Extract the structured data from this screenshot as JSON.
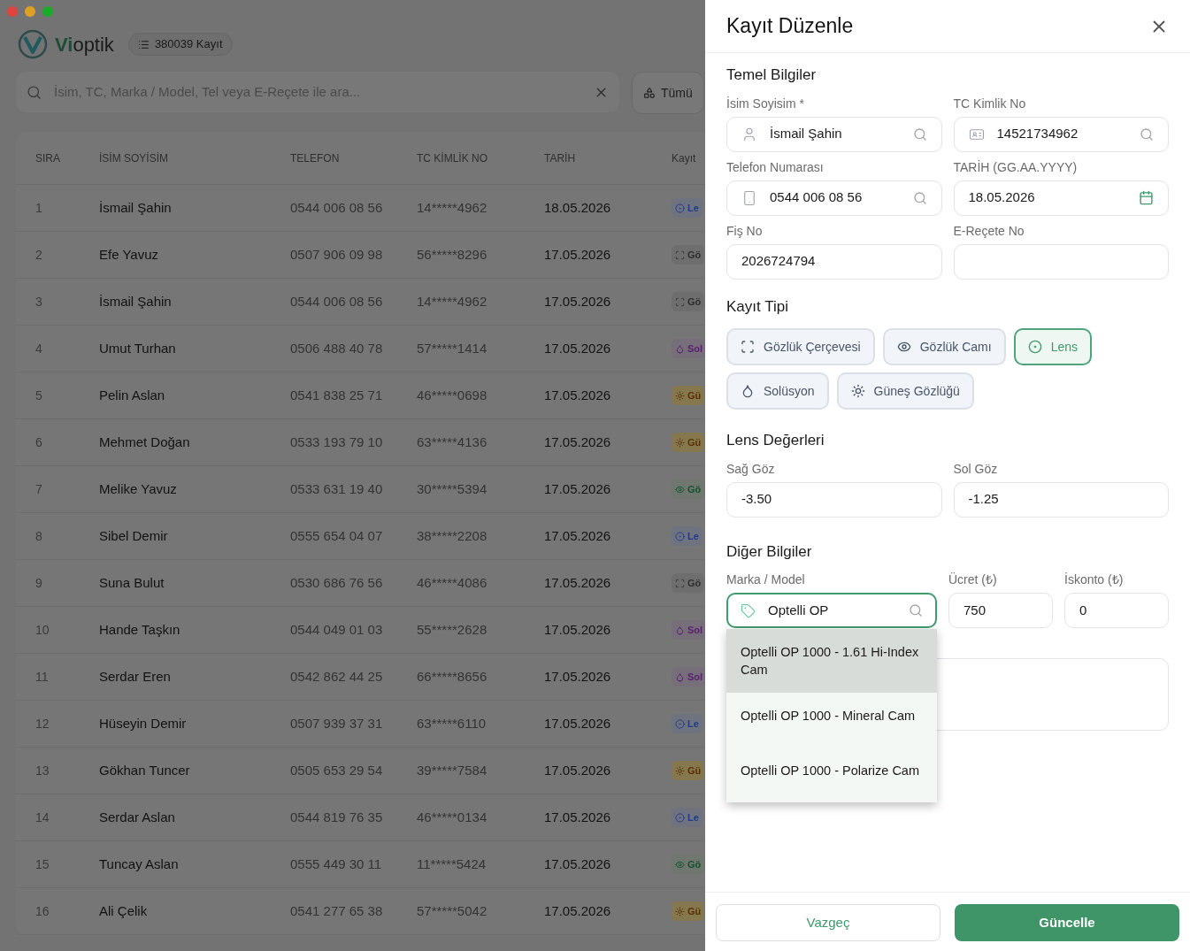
{
  "app": {
    "logo_accent": "Vi",
    "logo_rest": "optik",
    "record_count": "380039 Kayıt",
    "search": {
      "placeholder": "İsim, TC, Marka / Model, Tel veya E-Reçete ile ara..."
    },
    "filter": {
      "label": "Tümü"
    }
  },
  "table": {
    "columns": [
      "SIRA",
      "İSİM SOYİSİM",
      "TELEFON",
      "TC KİMLİK NO",
      "TARİH",
      "Kayıt"
    ],
    "rows": [
      {
        "no": "1",
        "name": "İsmail Şahin",
        "phone": "0544 006 08 56",
        "tc": "14*****4962",
        "date": "18.05.2026",
        "type": {
          "kind": "lens",
          "label": "Le"
        }
      },
      {
        "no": "2",
        "name": "Efe Yavuz",
        "phone": "0507 906 09 98",
        "tc": "56*****8296",
        "date": "17.05.2026",
        "type": {
          "kind": "frame",
          "label": "Gö"
        }
      },
      {
        "no": "3",
        "name": "İsmail Şahin",
        "phone": "0544 006 08 56",
        "tc": "14*****4962",
        "date": "17.05.2026",
        "type": {
          "kind": "frame",
          "label": "Gö"
        }
      },
      {
        "no": "4",
        "name": "Umut Turhan",
        "phone": "0506 488 40 78",
        "tc": "57*****1414",
        "date": "17.05.2026",
        "type": {
          "kind": "solution",
          "label": "Sol"
        }
      },
      {
        "no": "5",
        "name": "Pelin Aslan",
        "phone": "0541 838 25 71",
        "tc": "46*****0698",
        "date": "17.05.2026",
        "type": {
          "kind": "sun",
          "label": "Gü"
        }
      },
      {
        "no": "6",
        "name": "Mehmet Doğan",
        "phone": "0533 193 79 10",
        "tc": "63*****4136",
        "date": "17.05.2026",
        "type": {
          "kind": "sun",
          "label": "Gü"
        }
      },
      {
        "no": "7",
        "name": "Melike Yavuz",
        "phone": "0533 631 19 40",
        "tc": "30*****5394",
        "date": "17.05.2026",
        "type": {
          "kind": "glass",
          "label": "Gö"
        }
      },
      {
        "no": "8",
        "name": "Sibel Demir",
        "phone": "0555 654 04 07",
        "tc": "38*****2208",
        "date": "17.05.2026",
        "type": {
          "kind": "lens",
          "label": "Le"
        }
      },
      {
        "no": "9",
        "name": "Suna Bulut",
        "phone": "0530 686 76 56",
        "tc": "46*****4086",
        "date": "17.05.2026",
        "type": {
          "kind": "frame",
          "label": "Gö"
        }
      },
      {
        "no": "10",
        "name": "Hande Taşkın",
        "phone": "0544 049 01 03",
        "tc": "55*****2628",
        "date": "17.05.2026",
        "type": {
          "kind": "solution",
          "label": "Sol"
        }
      },
      {
        "no": "11",
        "name": "Serdar Eren",
        "phone": "0542 862 44 25",
        "tc": "66*****8656",
        "date": "17.05.2026",
        "type": {
          "kind": "solution",
          "label": "Sol"
        }
      },
      {
        "no": "12",
        "name": "Hüseyin Demir",
        "phone": "0507 939 37 31",
        "tc": "63*****6110",
        "date": "17.05.2026",
        "type": {
          "kind": "lens",
          "label": "Le"
        }
      },
      {
        "no": "13",
        "name": "Gökhan Tuncer",
        "phone": "0505 653 29 54",
        "tc": "39*****7584",
        "date": "17.05.2026",
        "type": {
          "kind": "sun",
          "label": "Gü"
        }
      },
      {
        "no": "14",
        "name": "Serdar Aslan",
        "phone": "0544 819 76 35",
        "tc": "46*****0134",
        "date": "17.05.2026",
        "type": {
          "kind": "lens",
          "label": "Le"
        }
      },
      {
        "no": "15",
        "name": "Tuncay Aslan",
        "phone": "0555 449 30 11",
        "tc": "11*****5424",
        "date": "17.05.2026",
        "type": {
          "kind": "glass",
          "label": "Gö"
        }
      },
      {
        "no": "16",
        "name": "Ali Çelik",
        "phone": "0541 277 65 38",
        "tc": "57*****5042",
        "date": "17.05.2026",
        "type": {
          "kind": "sun",
          "label": "Gü"
        }
      }
    ]
  },
  "drawer": {
    "title": "Kayıt Düzenle",
    "basic": {
      "heading": "Temel Bilgiler",
      "fields": [
        {
          "label": "İsim Soyisim *",
          "value": "İsmail Şahin"
        },
        {
          "label": "TC Kimlik No",
          "value": "14521734962"
        },
        {
          "label": "Telefon Numarası",
          "value": "0544 006 08 56"
        },
        {
          "label": "TARİH (GG.AA.YYYY)",
          "value": "18.05.2026"
        },
        {
          "label": "Fiş No",
          "value": "2026724794"
        },
        {
          "label": "E-Reçete No"
        }
      ]
    },
    "record_type": {
      "heading": "Kayıt Tipi",
      "options": [
        {
          "kind": "frame",
          "label": "Gözlük Çerçevesi",
          "selected": false
        },
        {
          "kind": "glass",
          "label": "Gözlük Camı",
          "selected": false
        },
        {
          "kind": "lens",
          "label": "Lens",
          "selected": true
        },
        {
          "kind": "solution",
          "label": "Solüsyon",
          "selected": false
        },
        {
          "kind": "sun",
          "label": "Güneş Gözlüğü",
          "selected": false
        }
      ]
    },
    "lens": {
      "heading": "Lens Değerleri",
      "fields": [
        {
          "label": "Sağ Göz",
          "value": "-3.50"
        },
        {
          "label": "Sol Göz",
          "value": "-1.25"
        }
      ]
    },
    "other": {
      "heading": "Diğer Bilgiler",
      "brand": {
        "label": "Marka / Model",
        "value": "Optelli OP",
        "focused": true
      },
      "price": {
        "label": "Ücret (₺)",
        "value": "750"
      },
      "discount": {
        "label": "İskonto (₺)",
        "value": "0"
      },
      "suggestions": [
        {
          "label": "Optelli OP 1000 - 1.61 Hi-Index Cam",
          "selected": true
        },
        {
          "label": "Optelli OP 1000 - Mineral Cam",
          "selected": false
        },
        {
          "label": "Optelli OP 1000 - Polarize Cam",
          "selected": false
        }
      ]
    },
    "footer": {
      "cancel": "Vazgeç",
      "submit": "Güncelle"
    }
  }
}
